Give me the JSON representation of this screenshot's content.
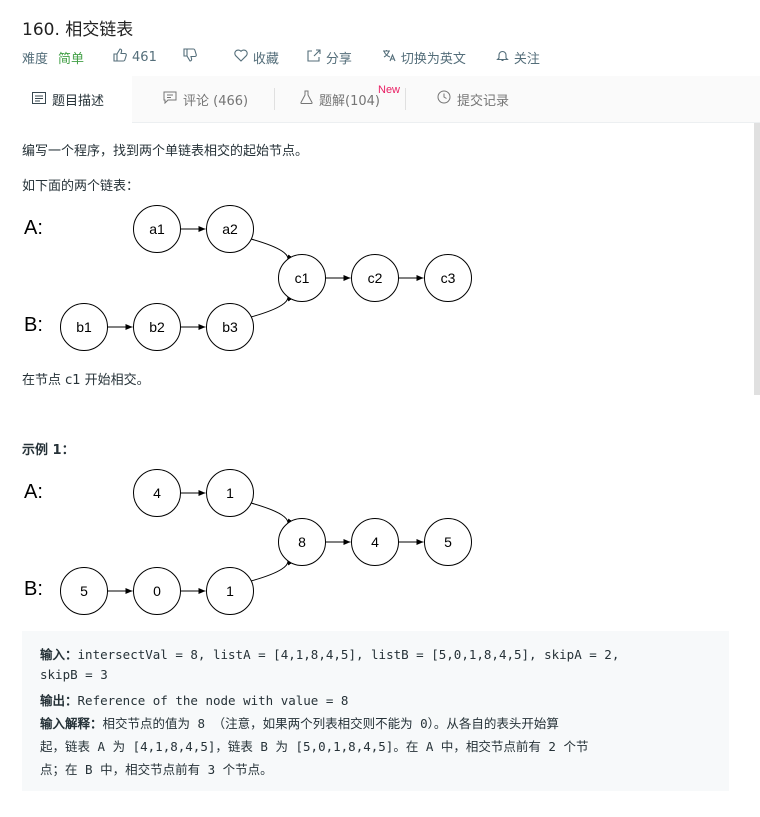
{
  "problem": {
    "title": "160. 相交链表",
    "difficulty_label": "难度",
    "difficulty": "简单",
    "likes": "461",
    "favorite_label": "收藏",
    "share_label": "分享",
    "switch_lang_label": "切换为英文",
    "follow_label": "关注"
  },
  "tabs": [
    {
      "label": "题目描述",
      "icon": "description-icon"
    },
    {
      "label": "评论 (466)",
      "icon": "comment-icon"
    },
    {
      "label": "题解(104)",
      "icon": "flask-icon",
      "badge": "New"
    },
    {
      "label": "提交记录",
      "icon": "clock-icon"
    }
  ],
  "description": {
    "intro": "编写一个程序，找到两个单链表相交的起始节点。",
    "lead": "如下面的两个链表：",
    "after": "在节点 c1 开始相交。",
    "example_title": "示例 1："
  },
  "diagram1": {
    "label_a": "A:",
    "label_b": "B:",
    "a_nodes": [
      "a1",
      "a2"
    ],
    "b_nodes": [
      "b1",
      "b2",
      "b3"
    ],
    "c_nodes": [
      "c1",
      "c2",
      "c3"
    ]
  },
  "diagram2": {
    "label_a": "A:",
    "label_b": "B:",
    "a_nodes": [
      "4",
      "1"
    ],
    "b_nodes": [
      "5",
      "0",
      "1"
    ],
    "c_nodes": [
      "8",
      "4",
      "5"
    ]
  },
  "example": {
    "input_key": "输入：",
    "input_line1": "intersectVal = 8, listA = [4,1,8,4,5], listB = [5,0,1,8,4,5], skipA = 2,",
    "input_line2": "skipB = 3",
    "output_key": "输出：",
    "output_value": "Reference of the node with value = 8",
    "explain_key": "输入解释：",
    "explain_line1": "相交节点的值为 8 （注意，如果两个列表相交则不能为 0）。从各自的表头开始算",
    "explain_line2": "起，链表 A 为 [4,1,8,4,5]，链表 B 为 [5,0,1,8,4,5]。在 A 中，相交节点前有 2 个节",
    "explain_line3": "点；在 B 中，相交节点前有 3 个节点。"
  }
}
